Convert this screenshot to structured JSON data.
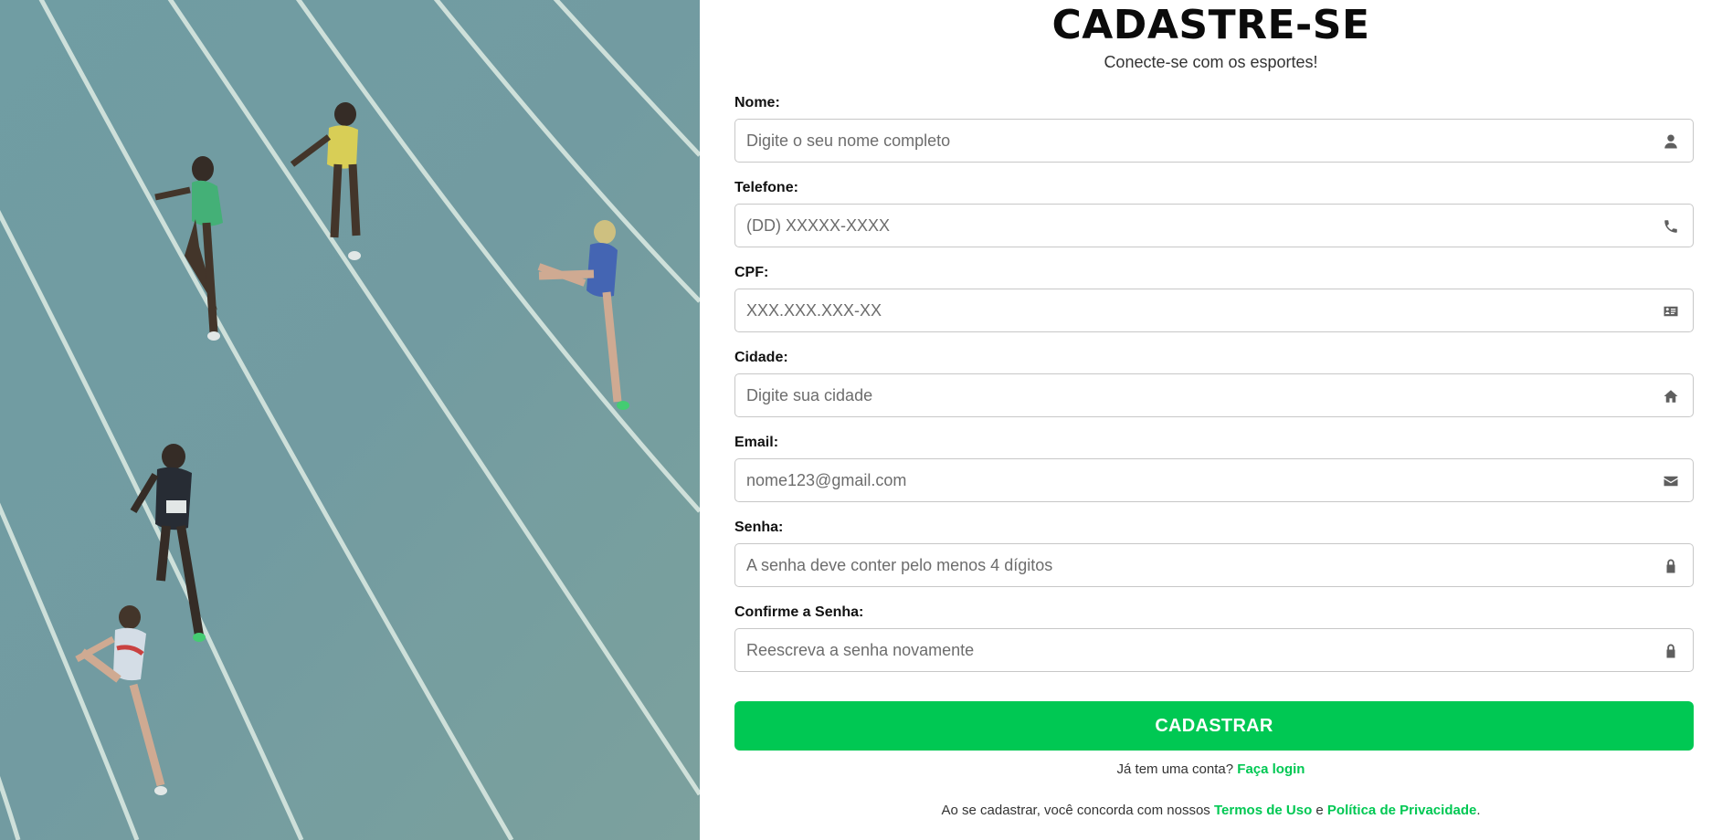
{
  "hero": {
    "scene": "athletics-track-runners"
  },
  "header": {
    "title": "CADASTRE-SE",
    "subtitle": "Conecte-se com os esportes!"
  },
  "form": {
    "fields": [
      {
        "label": "Nome:",
        "placeholder": "Digite o seu nome completo",
        "value": "",
        "icon": "user-icon"
      },
      {
        "label": "Telefone:",
        "placeholder": "(DD) XXXXX-XXXX",
        "value": "",
        "icon": "phone-icon"
      },
      {
        "label": "CPF:",
        "placeholder": "XXX.XXX.XXX-XX",
        "value": "",
        "icon": "id-card-icon"
      },
      {
        "label": "Cidade:",
        "placeholder": "Digite sua cidade",
        "value": "",
        "icon": "home-icon"
      },
      {
        "label": "Email:",
        "placeholder": "nome123@gmail.com",
        "value": "",
        "icon": "envelope-icon"
      },
      {
        "label": "Senha:",
        "placeholder": "A senha deve conter pelo menos 4 dígitos",
        "value": "",
        "icon": "lock-icon"
      },
      {
        "label": "Confirme a Senha:",
        "placeholder": "Reescreva a senha novamente",
        "value": "",
        "icon": "lock-icon"
      }
    ],
    "submit_label": "CADASTRAR"
  },
  "footer": {
    "login_prompt": "Já tem uma conta?",
    "login_link": "Faça login",
    "terms_prefix": "Ao se cadastrar, você concorda com nossos",
    "terms_link": "Termos de Uso",
    "terms_and": "e",
    "privacy_link": "Política de Privacidade",
    "terms_suffix": "."
  },
  "colors": {
    "accent": "#00c853",
    "track": "#6f9aa0",
    "input_border": "#c7c7c7",
    "icon": "#5f5f5f"
  }
}
